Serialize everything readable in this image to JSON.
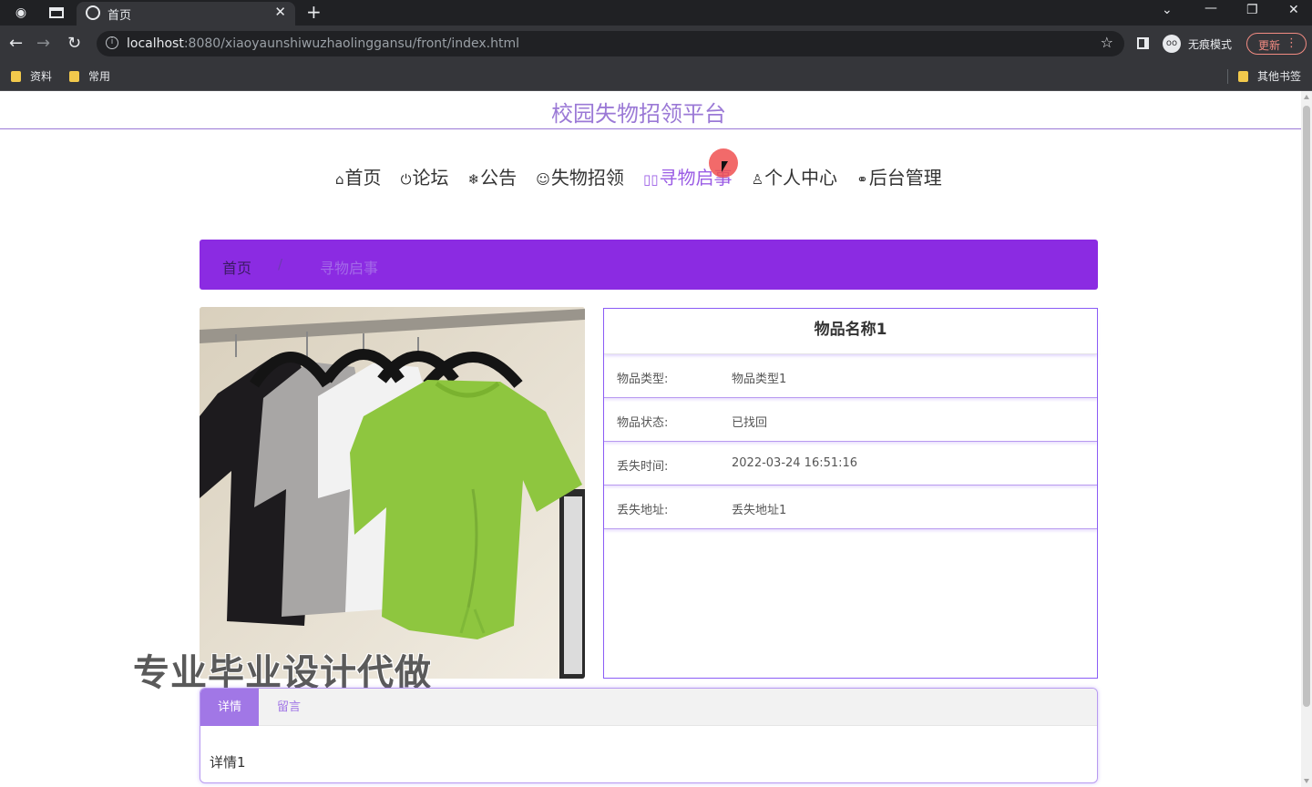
{
  "browser": {
    "tab_title": "首页",
    "url_host": "localhost",
    "url_rest": ":8080/xiaoyaunshiwuzhaolinggansu/front/index.html",
    "incognito_label": "无痕模式",
    "update_label": "更新",
    "bookmarks": [
      "资料",
      "常用"
    ],
    "other_bookmarks": "其他书签"
  },
  "site": {
    "title": "校园失物招领平台"
  },
  "menu": {
    "items": [
      {
        "icon": "⌂",
        "label": "首页"
      },
      {
        "icon": "⏻",
        "label": "论坛"
      },
      {
        "icon": "❄",
        "label": "公告"
      },
      {
        "icon": "☺",
        "label": "失物招领"
      },
      {
        "icon": "▯▯",
        "label": "寻物启事"
      },
      {
        "icon": "♙",
        "label": "个人中心"
      },
      {
        "icon": "⚭",
        "label": "后台管理"
      }
    ],
    "active_index": 4
  },
  "breadcrumb": {
    "home": "首页",
    "separator": "/",
    "current": "寻物启事"
  },
  "item": {
    "name": "物品名称1",
    "fields": [
      {
        "label": "物品类型:",
        "value": "物品类型1"
      },
      {
        "label": "物品状态:",
        "value": "已找回"
      },
      {
        "label": "丢失时间:",
        "value": "2022-03-24 16:51:16"
      },
      {
        "label": "丢失地址:",
        "value": "丢失地址1"
      }
    ]
  },
  "watermark": "专业毕业设计代做",
  "tabs": {
    "items": [
      "详情",
      "留言"
    ],
    "content": "详情1"
  },
  "colors": {
    "accent": "#9b79d6",
    "breadcrumb_bg": "#8b2be2",
    "tab_active": "#a177e6"
  }
}
